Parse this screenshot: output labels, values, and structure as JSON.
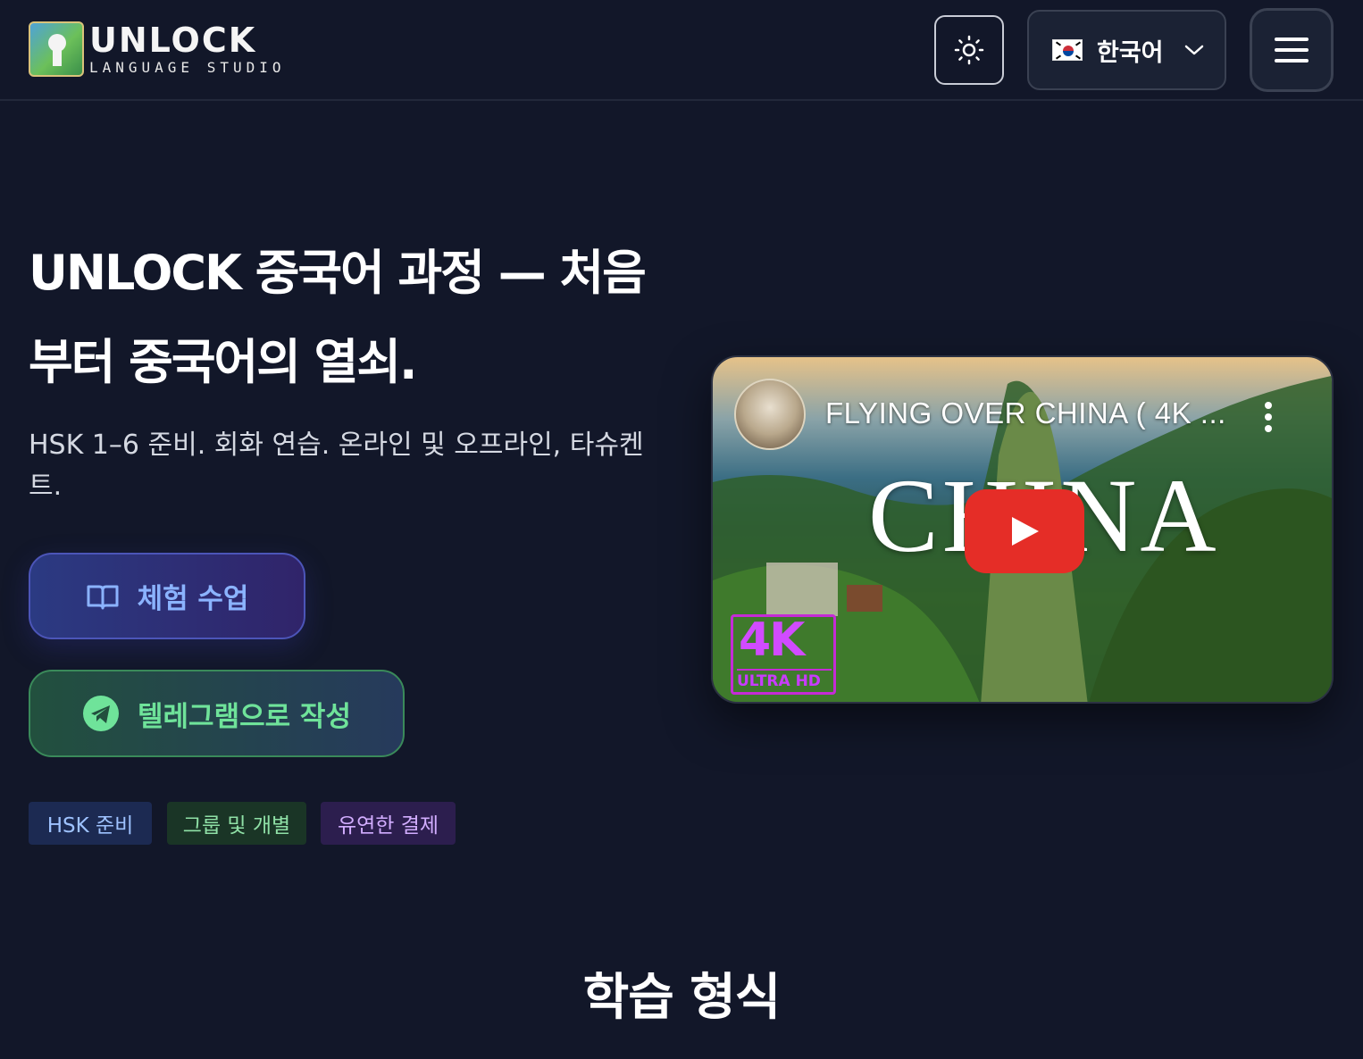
{
  "header": {
    "logo_title": "UNLOCK",
    "logo_subtitle": "LANGUAGE STUDIO",
    "theme_icon": "sun-icon",
    "language": {
      "flag": "kr-flag-icon",
      "label": "한국어",
      "caret": "chevron-down-icon"
    },
    "menu_icon": "hamburger-icon"
  },
  "hero": {
    "title": "UNLOCK 중국어 과정 — 처음부터 중국어의 열쇠.",
    "subtitle": "HSK 1–6 준비. 회화 연습. 온라인 및 오프라인, 타슈켄트.",
    "buttons": {
      "trial": {
        "label": "체험 수업",
        "icon": "book-open-icon"
      },
      "telegram": {
        "label": "텔레그램으로 작성",
        "icon": "telegram-icon"
      }
    },
    "tags": [
      "HSK 준비",
      "그룹 및 개별",
      "유연한 결제"
    ]
  },
  "video": {
    "title": "FLYING OVER CHINA ( 4K ...",
    "overlay_text": "CHINA",
    "badge_main": "4K",
    "badge_sub": "ULTRA HD",
    "play_icon": "play-icon",
    "more_icon": "more-vertical-icon"
  },
  "sections": {
    "formats_title": "학습 형식"
  },
  "colors": {
    "background": "#121729",
    "trial_text": "#8bb3ff",
    "telegram_text": "#6fe39a",
    "youtube_red": "#e52d27"
  }
}
